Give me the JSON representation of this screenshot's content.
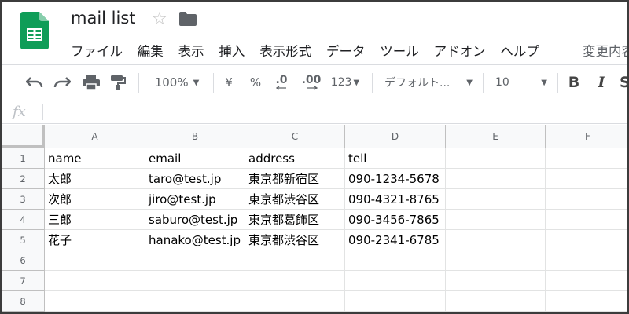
{
  "app": {
    "doc_title": "mail list",
    "menu": [
      "ファイル",
      "編集",
      "表示",
      "挿入",
      "表示形式",
      "データ",
      "ツール",
      "アドオン",
      "ヘルプ"
    ],
    "menu_last_edit": "変更内容"
  },
  "toolbar": {
    "zoom": "100%",
    "currency": "¥",
    "percent": "%",
    "decrease_decimal": ".0",
    "increase_decimal": ".00",
    "number_format": "123",
    "font": "デフォルト...",
    "font_size": "10",
    "bold": "B",
    "italic": "I"
  },
  "formula_bar": {
    "fx": "fx",
    "value": ""
  },
  "sheet": {
    "columns": [
      "A",
      "B",
      "C",
      "D",
      "E",
      "F"
    ],
    "rows": [
      "1",
      "2",
      "3",
      "4",
      "5",
      "6",
      "7",
      "8"
    ],
    "cells": [
      [
        "name",
        "email",
        "address",
        "tell",
        "",
        ""
      ],
      [
        "太郎",
        "taro@test.jp",
        "東京都新宿区",
        "090-1234-5678",
        "",
        ""
      ],
      [
        "次郎",
        "jiro@test.jp",
        "東京都渋谷区",
        "090-4321-8765",
        "",
        ""
      ],
      [
        "三郎",
        "saburo@test.jp",
        "東京都葛飾区",
        "090-3456-7865",
        "",
        ""
      ],
      [
        "花子",
        "hanako@test.jp",
        "東京都渋谷区",
        "090-2341-6785",
        "",
        ""
      ],
      [
        "",
        "",
        "",
        "",
        "",
        ""
      ],
      [
        "",
        "",
        "",
        "",
        "",
        ""
      ],
      [
        "",
        "",
        "",
        "",
        "",
        ""
      ]
    ]
  },
  "colors": {
    "sheets_green": "#0f9d58",
    "header_bg": "#f8f9fa",
    "grid_line": "#e2e3e3",
    "icon_gray": "#5f6368"
  }
}
